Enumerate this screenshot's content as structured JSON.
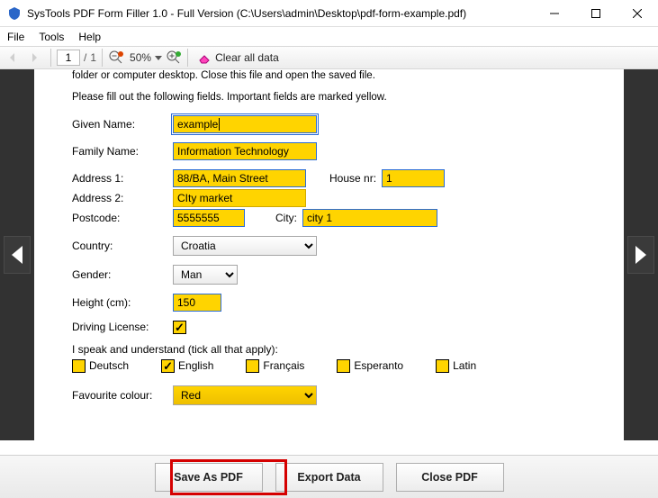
{
  "window": {
    "title": "SysTools PDF Form Filler 1.0 - Full Version (C:\\Users\\admin\\Desktop\\pdf-form-example.pdf)"
  },
  "menu": {
    "file": "File",
    "tools": "Tools",
    "help": "Help"
  },
  "toolbar": {
    "page_current": "1",
    "page_sep": "/",
    "page_total": "1",
    "zoom": "50%",
    "clear_all": "Clear all data"
  },
  "doc": {
    "line1": "folder or computer desktop. Close this file and open the saved file.",
    "line2": "Please fill out the following fields. Important fields are marked yellow.",
    "labels": {
      "given_name": "Given Name:",
      "family_name": "Family Name:",
      "address1": "Address 1:",
      "address2": "Address 2:",
      "house_nr": "House nr:",
      "postcode": "Postcode:",
      "city": "City:",
      "country": "Country:",
      "gender": "Gender:",
      "height": "Height (cm):",
      "driving": "Driving License:",
      "lang_header": "I speak and understand (tick all that apply):",
      "fav_colour": "Favourite colour:"
    },
    "values": {
      "given_name": "example",
      "family_name": "Information Technology",
      "address1": "88/BA, Main Street",
      "address2": "CIty market",
      "house_nr": "1",
      "postcode": "5555555",
      "city": "city 1",
      "country": "Croatia",
      "gender": "Man",
      "height": "150",
      "driving_checked": true,
      "fav_colour": "Red"
    },
    "languages": [
      {
        "key": "de",
        "label": "Deutsch",
        "checked": false
      },
      {
        "key": "en",
        "label": "English",
        "checked": true
      },
      {
        "key": "fr",
        "label": "Français",
        "checked": false
      },
      {
        "key": "eo",
        "label": "Esperanto",
        "checked": false
      },
      {
        "key": "la",
        "label": "Latin",
        "checked": false
      }
    ]
  },
  "buttons": {
    "save_as_pdf": "Save As PDF",
    "export_data": "Export Data",
    "close_pdf": "Close PDF"
  }
}
